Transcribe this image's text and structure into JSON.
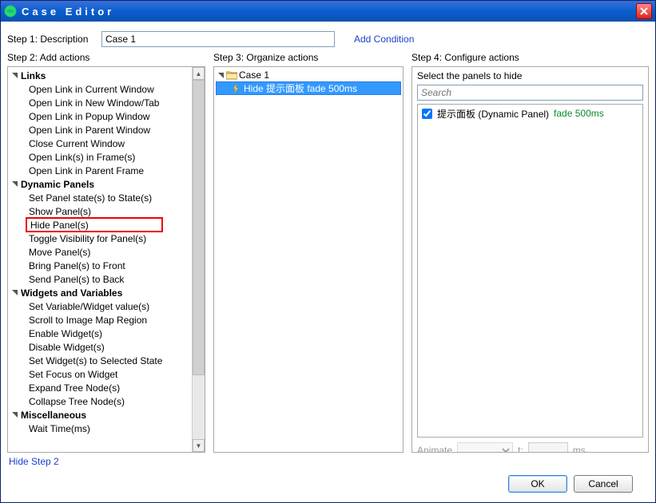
{
  "title": "Case Editor",
  "step1": {
    "label": "Step 1: Description",
    "value": "Case 1",
    "add_condition": "Add Condition"
  },
  "step2": {
    "header": "Step 2: Add actions",
    "groups": [
      {
        "label": "Links",
        "items": [
          "Open Link in Current Window",
          "Open Link in New Window/Tab",
          "Open Link in Popup Window",
          "Open Link in Parent Window",
          "Close Current Window",
          "Open Link(s) in Frame(s)",
          "Open Link in Parent Frame"
        ]
      },
      {
        "label": "Dynamic Panels",
        "items": [
          "Set Panel state(s) to State(s)",
          "Show Panel(s)",
          "Hide Panel(s)",
          "Toggle Visibility for Panel(s)",
          "Move Panel(s)",
          "Bring Panel(s) to Front",
          "Send Panel(s) to Back"
        ]
      },
      {
        "label": "Widgets and Variables",
        "items": [
          "Set Variable/Widget value(s)",
          "Scroll to Image Map Region",
          "Enable Widget(s)",
          "Disable Widget(s)",
          "Set Widget(s) to Selected State",
          "Set Focus on Widget",
          "Expand Tree Node(s)",
          "Collapse Tree Node(s)"
        ]
      },
      {
        "label": "Miscellaneous",
        "items": [
          "Wait Time(ms)"
        ]
      }
    ],
    "hide_step2": "Hide Step 2"
  },
  "step3": {
    "header": "Step 3: Organize actions",
    "case_label": "Case 1",
    "action_label": "Hide 提示面板 fade 500ms"
  },
  "step4": {
    "header": "Step 4: Configure actions",
    "title": "Select the panels to hide",
    "search_placeholder": "Search",
    "panel_label": "提示面板 (Dynamic Panel)",
    "panel_fade": "fade 500ms",
    "animate_label": "Animate",
    "t_label": "t:",
    "ms_label": "ms"
  },
  "footer": {
    "ok": "OK",
    "cancel": "Cancel"
  }
}
